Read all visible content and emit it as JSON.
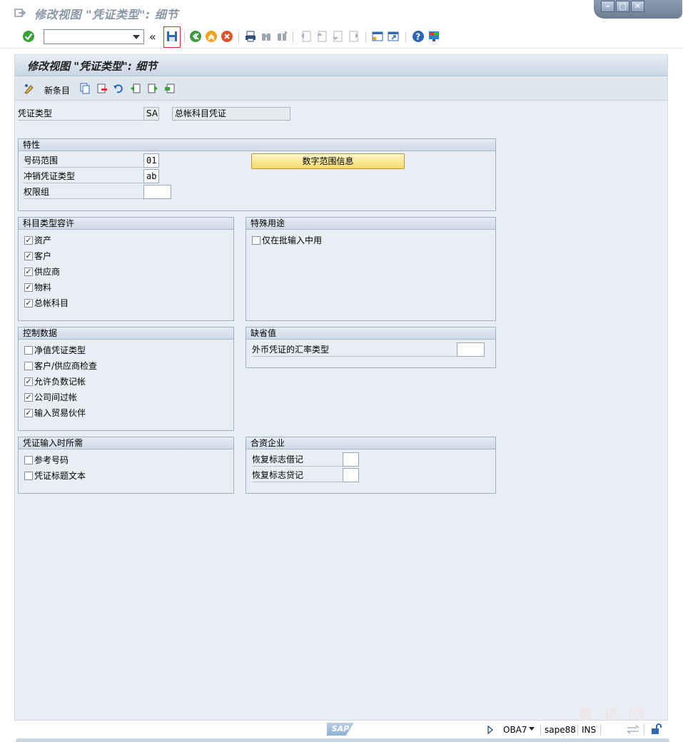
{
  "window": {
    "title": "修改视图 \"凭证类型\": 细节"
  },
  "system_toolbar": {
    "command_value": "",
    "back_glyph": "«"
  },
  "header": {
    "title": "修改视图 \"凭证类型\": 细节"
  },
  "app_toolbar": {
    "new_entries_label": "新条目"
  },
  "doc_type": {
    "label": "凭证类型",
    "code": "SA",
    "description": "总帐科目凭证"
  },
  "properties": {
    "title": "特性",
    "number_range_label": "号码范围",
    "number_range_value": "01",
    "reverse_type_label": "冲销凭证类型",
    "reverse_type_value": "ab",
    "auth_group_label": "权限组",
    "auth_group_value": "",
    "number_range_button": "数字范围信息"
  },
  "account_types": {
    "title": "科目类型容许",
    "items": [
      {
        "label": "资产",
        "checked": true
      },
      {
        "label": "客户",
        "checked": true
      },
      {
        "label": "供应商",
        "checked": true
      },
      {
        "label": "物料",
        "checked": true
      },
      {
        "label": "总帐科目",
        "checked": true
      }
    ]
  },
  "special_usage": {
    "title": "特殊用途",
    "items": [
      {
        "label": "仅在批输入中用",
        "checked": false
      }
    ]
  },
  "control_data": {
    "title": "控制数据",
    "items": [
      {
        "label": "净值凭证类型",
        "checked": false
      },
      {
        "label": "客户/供应商检查",
        "checked": false
      },
      {
        "label": "允许负数记帐",
        "checked": true
      },
      {
        "label": "公司间过帐",
        "checked": true
      },
      {
        "label": "输入贸易伙伴",
        "checked": true
      }
    ]
  },
  "defaults": {
    "title": "缺省值",
    "fx_rate_label": "外币凭证的汇率类型",
    "fx_rate_value": ""
  },
  "required_entry": {
    "title": "凭证输入时所需",
    "items": [
      {
        "label": "参考号码",
        "checked": false
      },
      {
        "label": "凭证标题文本",
        "checked": false
      }
    ]
  },
  "joint_venture": {
    "title": "合资企业",
    "debit_label": "恢复标志借记",
    "debit_value": "",
    "credit_label": "恢复标志贷记",
    "credit_value": ""
  },
  "status_bar": {
    "sap_logo": "SAP",
    "transaction": "OBA7",
    "server": "sape88",
    "mode": "INS"
  },
  "watermark": "寒 艳 网",
  "colors": {
    "save_highlight": "#e0322b",
    "button_yellow": "#f5d96a",
    "panel_bg": "#e9eef4"
  }
}
